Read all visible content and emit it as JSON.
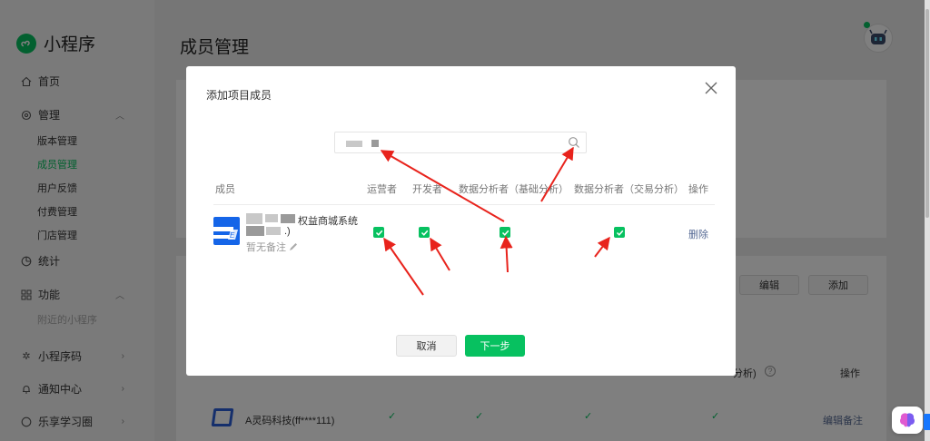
{
  "sidebar": {
    "brand": "小程序",
    "items": [
      {
        "label": "首页"
      },
      {
        "label": "管理"
      },
      {
        "label": "统计"
      },
      {
        "label": "功能"
      },
      {
        "label": "小程序码"
      },
      {
        "label": "通知中心"
      },
      {
        "label": "乐享学习圈"
      }
    ],
    "manage_sub": [
      "版本管理",
      "成员管理",
      "用户反馈",
      "付费管理",
      "门店管理"
    ],
    "feature_sub": [
      "附近的小程序"
    ]
  },
  "page": {
    "title": "成员管理"
  },
  "background": {
    "edit_btn": "编辑",
    "add_btn": "添加",
    "col_analysis_partial": "分析)",
    "col_action": "操作",
    "company_name": "A灵码科技(ff****111)",
    "edit_remark": "编辑备注"
  },
  "modal": {
    "title": "添加项目成员",
    "headers": {
      "member": "成员",
      "operator": "运营者",
      "developer": "开发者",
      "analyst_basic": "数据分析者（基础分析）",
      "analyst_trade": "数据分析者（交易分析）",
      "action": "操作"
    },
    "member": {
      "name_suffix": "权益商城系统",
      "name_line2": ".)",
      "remark": "暂无备注",
      "operator": true,
      "developer": true,
      "analyst_basic": true,
      "analyst_trade": true
    },
    "delete": "删除",
    "cancel": "取消",
    "next": "下一步"
  },
  "colors": {
    "primary": "#07c160",
    "link": "#576b95",
    "annotation": "#e8231c"
  },
  "icons": [
    "search-icon",
    "close-icon",
    "edit-icon",
    "check-icon",
    "home-icon",
    "gear-icon",
    "chart-icon",
    "grid-icon",
    "qrcode-icon",
    "bell-icon",
    "circle-icon",
    "chevron-icon"
  ]
}
